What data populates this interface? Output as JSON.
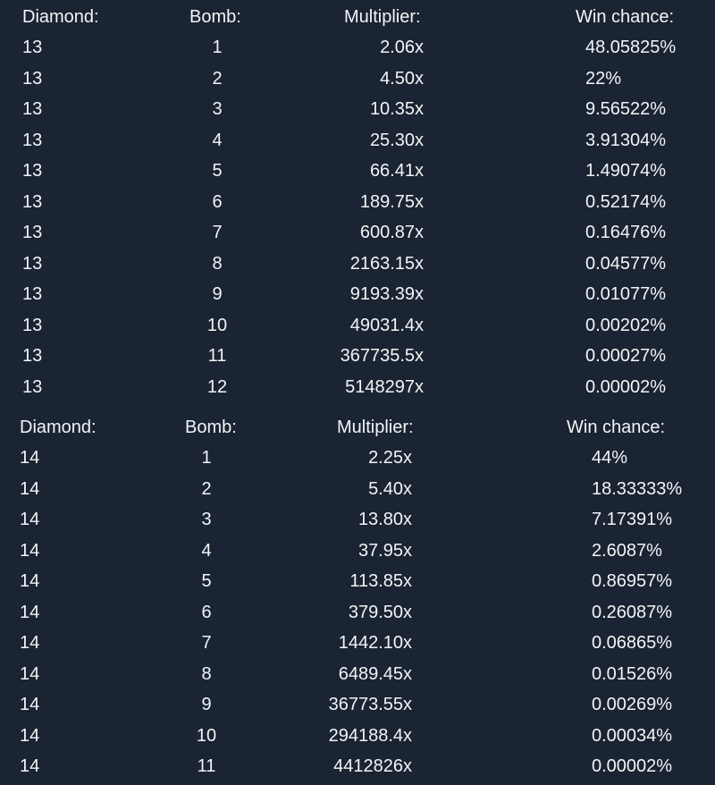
{
  "tables": [
    {
      "headers": {
        "diamond": "Diamond:",
        "bomb": "Bomb:",
        "multiplier": "Multiplier:",
        "win_chance": "Win chance:"
      },
      "rows": [
        {
          "diamond": "13",
          "bomb": "1",
          "multiplier": "2.06x",
          "win_chance": "48.05825%"
        },
        {
          "diamond": "13",
          "bomb": "2",
          "multiplier": "4.50x",
          "win_chance": "22%"
        },
        {
          "diamond": "13",
          "bomb": "3",
          "multiplier": "10.35x",
          "win_chance": "9.56522%"
        },
        {
          "diamond": "13",
          "bomb": "4",
          "multiplier": "25.30x",
          "win_chance": "3.91304%"
        },
        {
          "diamond": "13",
          "bomb": "5",
          "multiplier": "66.41x",
          "win_chance": "1.49074%"
        },
        {
          "diamond": "13",
          "bomb": "6",
          "multiplier": "189.75x",
          "win_chance": "0.52174%"
        },
        {
          "diamond": "13",
          "bomb": "7",
          "multiplier": "600.87x",
          "win_chance": "0.16476%"
        },
        {
          "diamond": "13",
          "bomb": "8",
          "multiplier": "2163.15x",
          "win_chance": "0.04577%"
        },
        {
          "diamond": "13",
          "bomb": "9",
          "multiplier": "9193.39x",
          "win_chance": "0.01077%"
        },
        {
          "diamond": "13",
          "bomb": "10",
          "multiplier": "49031.4x",
          "win_chance": "0.00202%"
        },
        {
          "diamond": "13",
          "bomb": "11",
          "multiplier": "367735.5x",
          "win_chance": "0.00027%"
        },
        {
          "diamond": "13",
          "bomb": "12",
          "multiplier": "5148297x",
          "win_chance": "0.00002%"
        }
      ]
    },
    {
      "headers": {
        "diamond": "Diamond:",
        "bomb": "Bomb:",
        "multiplier": "Multiplier:",
        "win_chance": "Win chance:"
      },
      "rows": [
        {
          "diamond": "14",
          "bomb": "1",
          "multiplier": "2.25x",
          "win_chance": "44%"
        },
        {
          "diamond": "14",
          "bomb": "2",
          "multiplier": "5.40x",
          "win_chance": "18.33333%"
        },
        {
          "diamond": "14",
          "bomb": "3",
          "multiplier": "13.80x",
          "win_chance": "7.17391%"
        },
        {
          "diamond": "14",
          "bomb": "4",
          "multiplier": "37.95x",
          "win_chance": "2.6087%"
        },
        {
          "diamond": "14",
          "bomb": "5",
          "multiplier": "113.85x",
          "win_chance": "0.86957%"
        },
        {
          "diamond": "14",
          "bomb": "6",
          "multiplier": "379.50x",
          "win_chance": "0.26087%"
        },
        {
          "diamond": "14",
          "bomb": "7",
          "multiplier": "1442.10x",
          "win_chance": "0.06865%"
        },
        {
          "diamond": "14",
          "bomb": "8",
          "multiplier": "6489.45x",
          "win_chance": "0.01526%"
        },
        {
          "diamond": "14",
          "bomb": "9",
          "multiplier": "36773.55x",
          "win_chance": "0.00269%"
        },
        {
          "diamond": "14",
          "bomb": "10",
          "multiplier": "294188.4x",
          "win_chance": "0.00034%"
        },
        {
          "diamond": "14",
          "bomb": "11",
          "multiplier": "4412826x",
          "win_chance": "0.00002%"
        }
      ]
    }
  ]
}
